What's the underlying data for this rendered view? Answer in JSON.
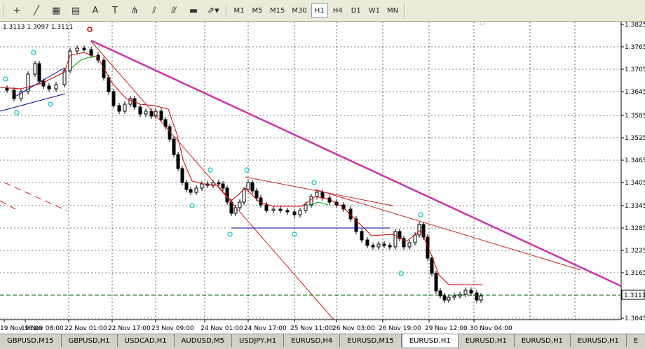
{
  "toolbar": {
    "tools": [
      {
        "name": "crosshair-icon",
        "glyph": "+"
      },
      {
        "name": "line-icon",
        "glyph": "╱"
      },
      {
        "name": "fibonacci-e-icon",
        "glyph": "▦"
      },
      {
        "name": "fibonacci-f-icon",
        "glyph": "▤"
      },
      {
        "name": "text-icon",
        "glyph": "A"
      },
      {
        "name": "text-label-icon",
        "glyph": "T"
      },
      {
        "name": "pitchfork-icon",
        "glyph": "⋔"
      },
      {
        "name": "gann-fan-icon",
        "glyph": "⫽"
      },
      {
        "name": "fibo-channel-icon",
        "glyph": "⫻"
      },
      {
        "name": "rectangle-icon",
        "glyph": "▬"
      },
      {
        "name": "arrows-icon",
        "glyph": "⇗▾"
      }
    ],
    "timeframes": [
      "M1",
      "M5",
      "M15",
      "M30",
      "H1",
      "H4",
      "D1",
      "W1",
      "MN"
    ],
    "active_timeframe": "H1"
  },
  "chart": {
    "ohlc_readout": "1.3113 1.3097 1.3111",
    "current_price": "1.3111",
    "colors": {
      "candle": "#000000",
      "ma": "#cc0000",
      "ma_green": "#00aa00",
      "trend_magenta": "#cc33aa",
      "trend_red": "#cc2222",
      "support_blue": "#000099",
      "fractal": "#33cccc",
      "price_line": "#006600"
    },
    "y_ticks": [
      "1.3825",
      "1.3765",
      "1.3705",
      "1.3645",
      "1.3585",
      "1.3525",
      "1.3465",
      "1.3405",
      "1.3345",
      "1.3285",
      "1.3225",
      "1.3165",
      "1.3045"
    ],
    "x_ticks": [
      "19 Nov 16:00",
      "19 Nov 08:00",
      "22 Nov 01:00",
      "22 Nov 17:00",
      "23 Nov 09:00",
      "24 Nov 01:00",
      "24 Nov 17:00",
      "25 Nov 11:00",
      "26 Nov 03:00",
      "26 Nov 19:00",
      "29 Nov 12:00",
      "30 Nov 04:00"
    ]
  },
  "tabs": [
    {
      "label": "GBPUSD,M15",
      "active": false
    },
    {
      "label": "GBPUSD,H1",
      "active": false
    },
    {
      "label": "USDCAD,H1",
      "active": false
    },
    {
      "label": "AUDUSD,M5",
      "active": false
    },
    {
      "label": "USDJPY,H1",
      "active": false
    },
    {
      "label": "EURUSD,H4",
      "active": false
    },
    {
      "label": "EURUSD,M15",
      "active": false
    },
    {
      "label": "EURUSD,H1",
      "active": true
    },
    {
      "label": "EURUSD,H1",
      "active": false
    },
    {
      "label": "EURUSD,H1",
      "active": false
    },
    {
      "label": "EURUSD,H1",
      "active": false
    },
    {
      "label": "E",
      "active": false
    }
  ]
}
